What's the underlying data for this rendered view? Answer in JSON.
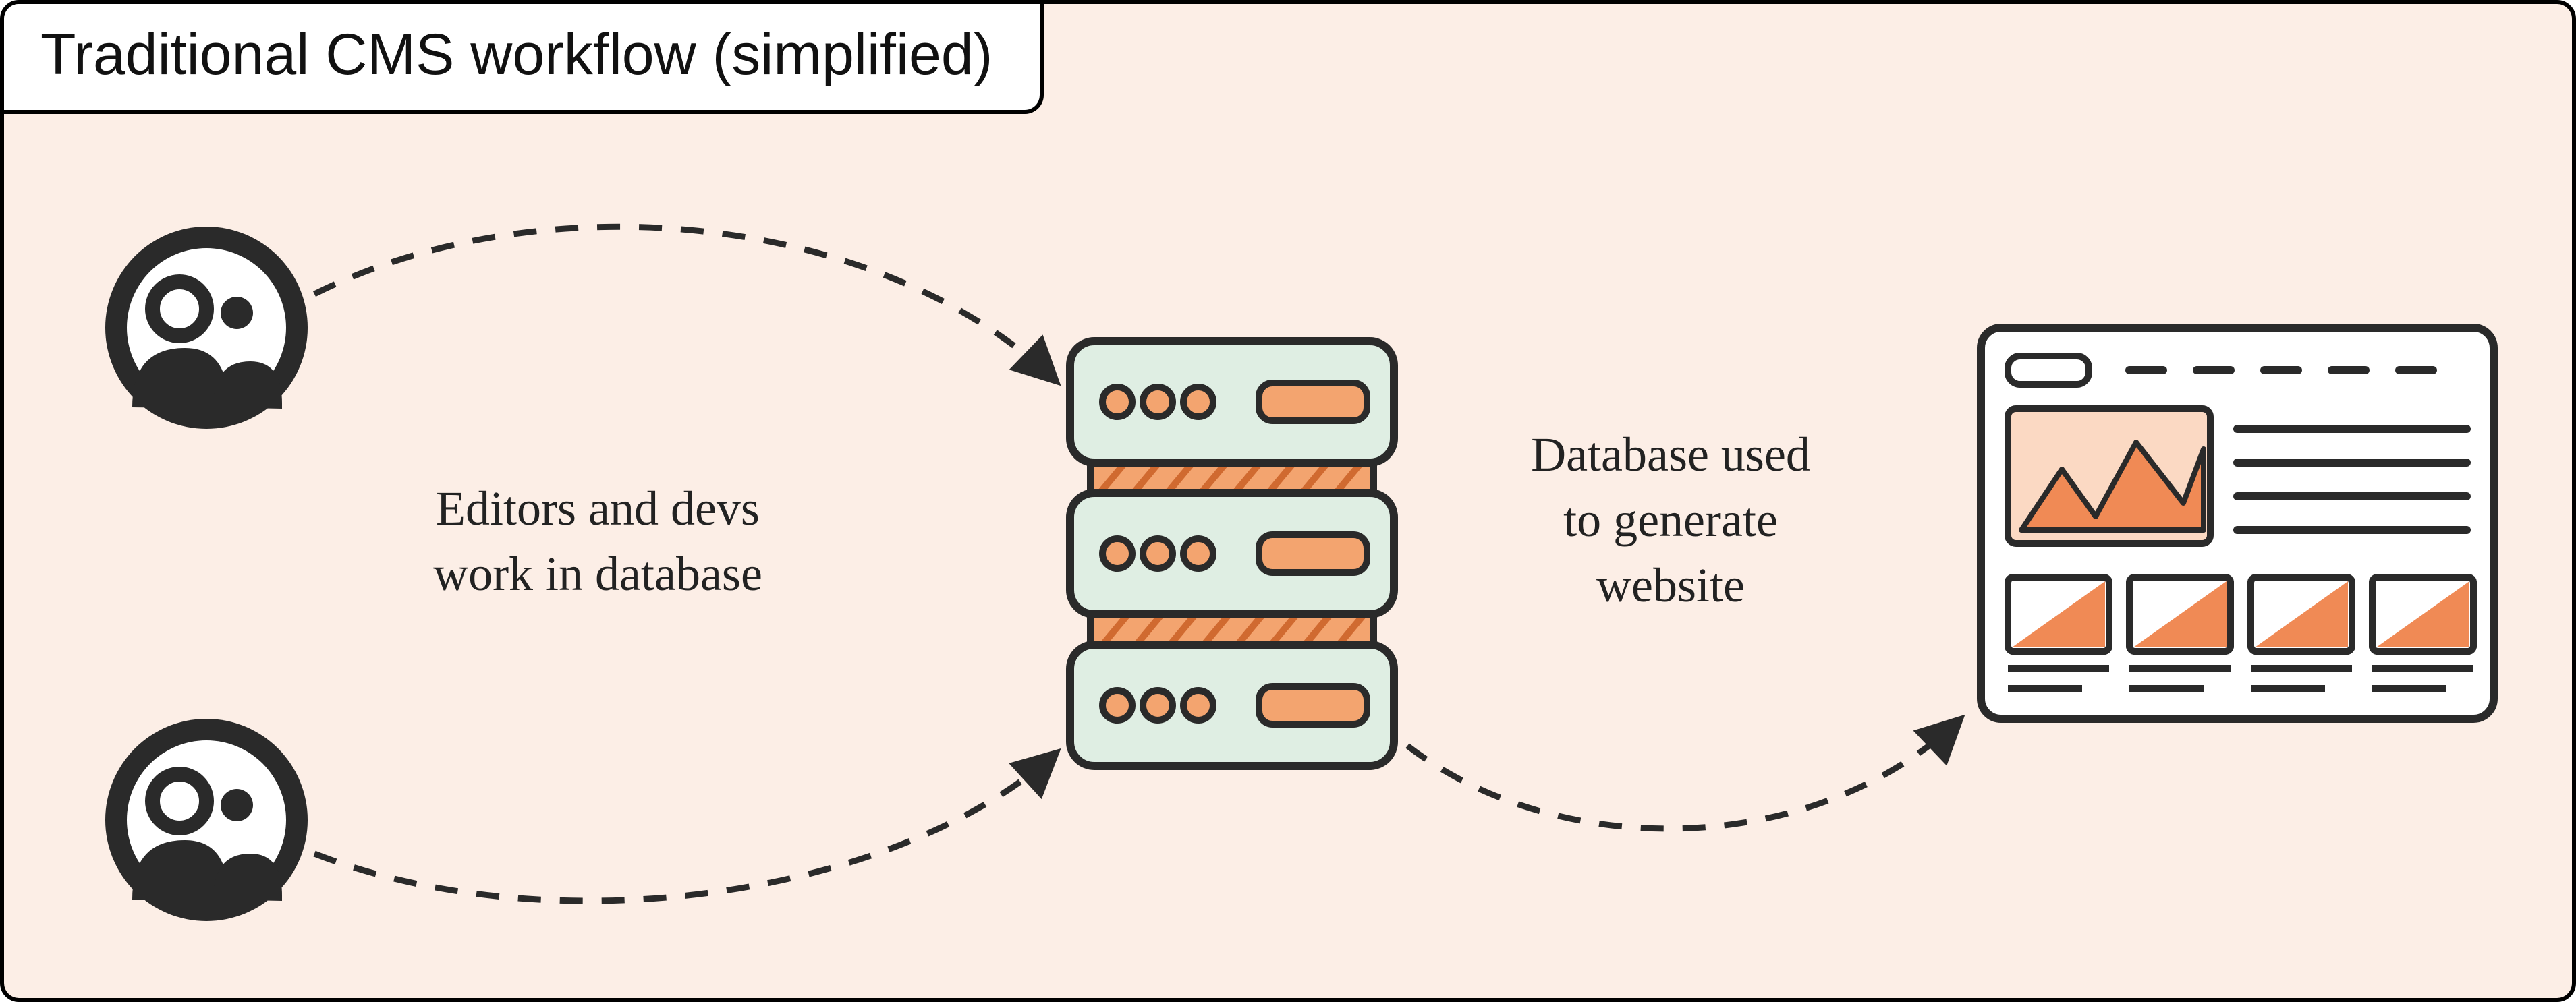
{
  "title": "Traditional CMS workflow (simplified)",
  "annotations": {
    "left": "Editors and devs\nwork in database",
    "right": "Database used\nto generate\nwebsite"
  },
  "nodes": {
    "editors_top": "people-icon",
    "editors_bottom": "people-icon",
    "database": "server-stack-icon",
    "website": "website-wireframe-icon"
  },
  "flows": [
    {
      "from": "editors_top",
      "to": "database"
    },
    {
      "from": "editors_bottom",
      "to": "database"
    },
    {
      "from": "database",
      "to": "website"
    }
  ],
  "colors": {
    "bg": "#fceee6",
    "accent_orange": "#f08a55",
    "accent_green": "#dfeee3",
    "ink": "#2a2a2a"
  }
}
